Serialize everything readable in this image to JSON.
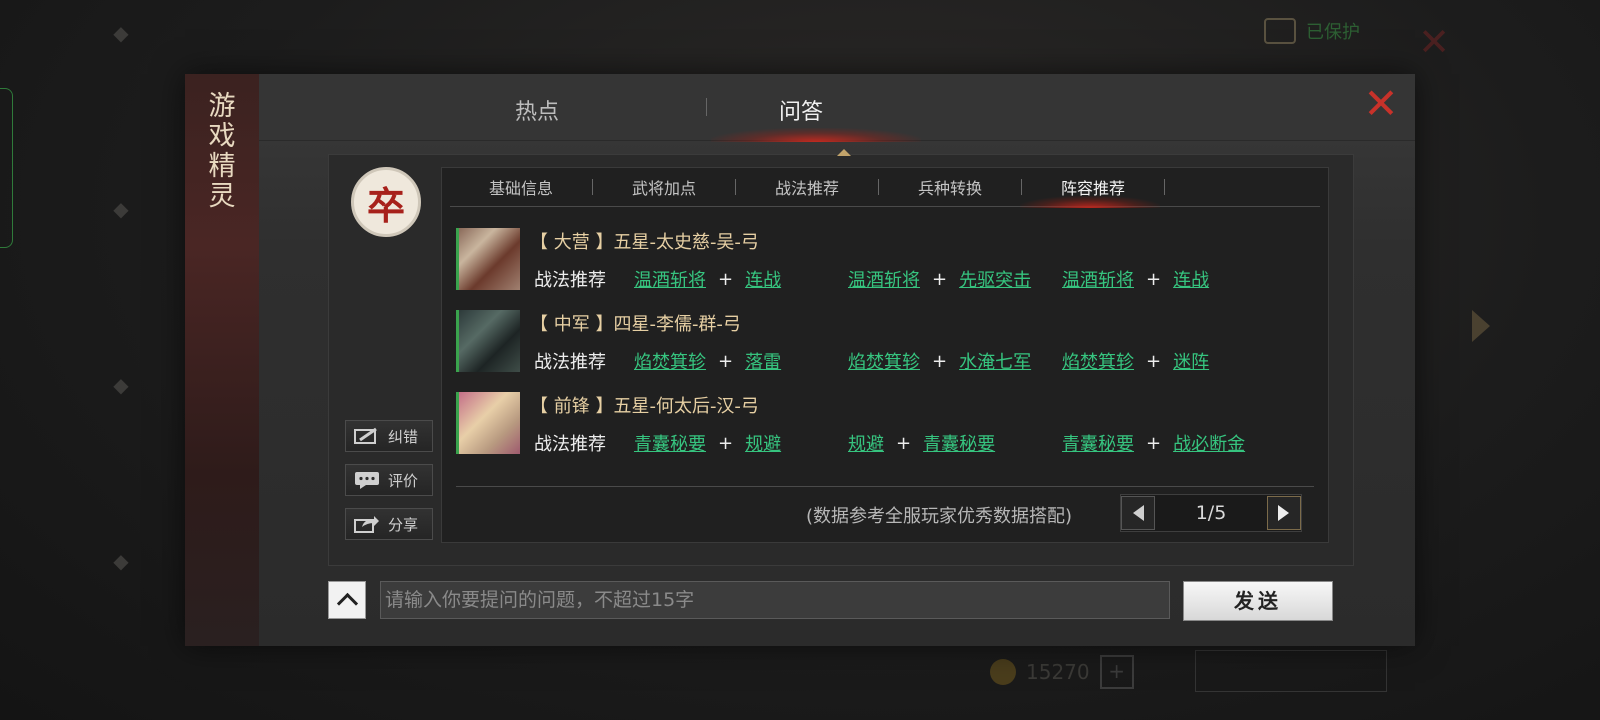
{
  "background": {
    "status_text": "已保护",
    "coins": "15270"
  },
  "dialog": {
    "side_title": "游戏精灵",
    "tabs": [
      {
        "label": "热点"
      },
      {
        "label": "问答"
      }
    ],
    "active_tab": "问答"
  },
  "avatar": {
    "char": "卒"
  },
  "side_buttons": {
    "report": "纠错",
    "rate": "评价",
    "share": "分享"
  },
  "subtabs": [
    {
      "label": "基础信息"
    },
    {
      "label": "武将加点"
    },
    {
      "label": "战法推荐"
    },
    {
      "label": "兵种转换"
    },
    {
      "label": "阵容推荐"
    }
  ],
  "active_subtab": "阵容推荐",
  "generals": [
    {
      "title": "【 大营 】五星-太史慈-吴-弓",
      "tactics_label": "战法推荐",
      "combos": [
        [
          "温酒斩将",
          "连战"
        ],
        [
          "温酒斩将",
          "先驱突击"
        ],
        [
          "温酒斩将",
          "连战"
        ]
      ]
    },
    {
      "title": "【 中军 】四星-李儒-群-弓",
      "tactics_label": "战法推荐",
      "combos": [
        [
          "焰焚箕轸",
          "落雷"
        ],
        [
          "焰焚箕轸",
          "水淹七军"
        ],
        [
          "焰焚箕轸",
          "迷阵"
        ]
      ]
    },
    {
      "title": "【 前锋 】五星-何太后-汉-弓",
      "tactics_label": "战法推荐",
      "combos": [
        [
          "青囊秘要",
          "规避"
        ],
        [
          "规避",
          "青囊秘要"
        ],
        [
          "青囊秘要",
          "战必断金"
        ]
      ]
    }
  ],
  "footer": {
    "note": "(数据参考全服玩家优秀数据搭配)",
    "page": "1/5"
  },
  "input": {
    "placeholder": "请输入你要提问的问题，不超过15字",
    "value": ""
  },
  "send_label": "发送",
  "colors": {
    "link": "#36c47f",
    "accent_red": "#c8322a",
    "title_gold": "#e6cfa3"
  }
}
